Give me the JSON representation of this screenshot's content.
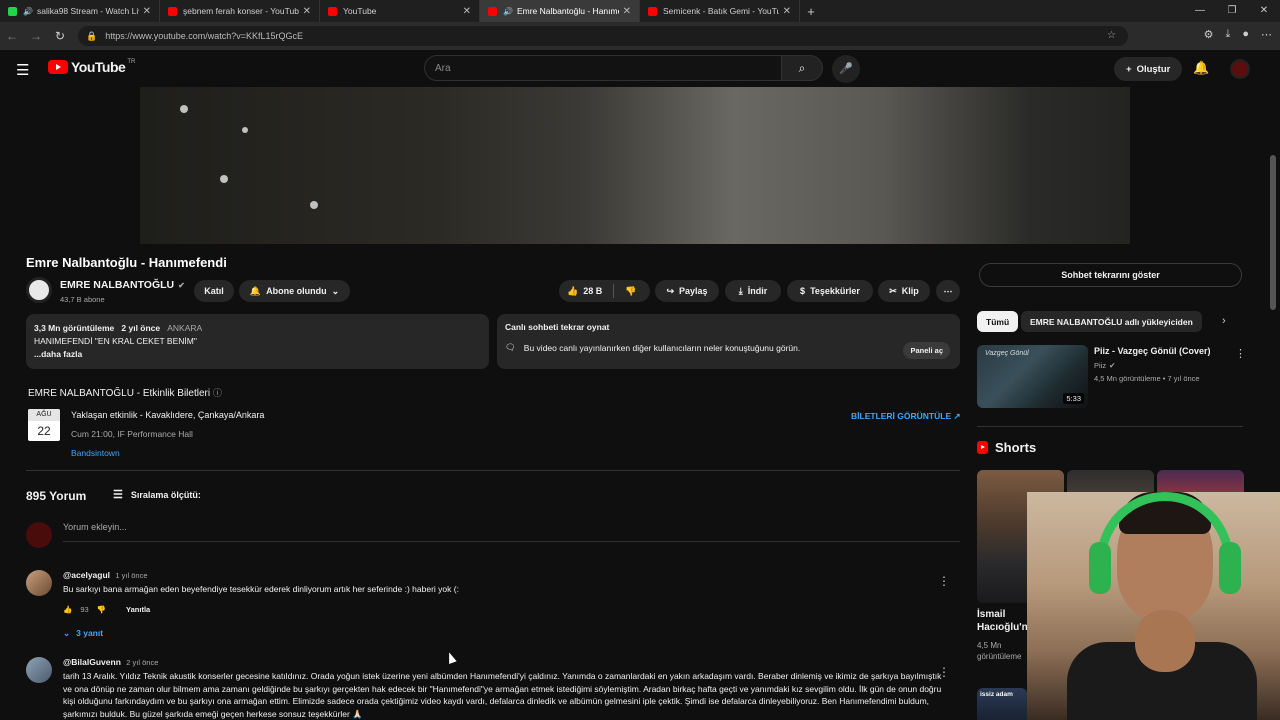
{
  "browser": {
    "tabs": [
      {
        "label": "salika98 Stream - Watch Live",
        "icon": "kick-favicon",
        "audio": true
      },
      {
        "label": "şebnem ferah konser - YouTube",
        "icon": "youtube-favicon",
        "audio": false
      },
      {
        "label": "YouTube",
        "icon": "youtube-favicon",
        "audio": false
      },
      {
        "label": "Emre Nalbantoğlu - Hanımef",
        "icon": "youtube-favicon",
        "audio": true,
        "active": true
      },
      {
        "label": "Semicenk - Batık Gemi - YouTube",
        "icon": "youtube-favicon",
        "audio": false
      }
    ],
    "url": "https://www.youtube.com/watch?v=KKfL15rQGcE"
  },
  "header": {
    "logo_text": "YouTube",
    "region": "TR",
    "search_placeholder": "Ara",
    "create_label": "Oluştur"
  },
  "video": {
    "title": "Emre Nalbantoğlu - Hanımefendi",
    "channel": "EMRE NALBANTOĞLU",
    "subscribers": "43,7 B abone",
    "join_label": "Katıl",
    "subscribed_label": "Abone olundu",
    "likes": "28 B",
    "share_label": "Paylaş",
    "download_label": "İndir",
    "thanks_label": "Teşekkürler",
    "clip_label": "Klip"
  },
  "description": {
    "views": "3,3 Mn görüntüleme",
    "age": "2 yıl önce",
    "location": "ANKARA",
    "line": "HANIMEFENDİ \"EN KRAL CEKET BENİM\"",
    "more": "...daha fazla"
  },
  "livechat_box": {
    "title": "Canlı sohbeti tekrar oynat",
    "text": "Bu video canlı yayınlanırken diğer kullanıcıların neler konuştuğunu görün.",
    "button": "Paneli aç"
  },
  "events": {
    "title": "EMRE NALBANTOĞLU - Etkinlik Biletleri",
    "month": "AĞU",
    "day": "22",
    "event_title": "Yaklaşan etkinlik - Kavaklıdere, Çankaya/Ankara",
    "event_time": "Cum 21:00, IF Performance Hall",
    "source": "Bandsintown",
    "tickets_link": "BİLETLERİ GÖRÜNTÜLE"
  },
  "comments": {
    "count": "895 Yorum",
    "sort_label": "Sıralama ölçütü:",
    "add_placeholder": "Yorum ekleyin...",
    "reply_label": "Yanıtla",
    "items": [
      {
        "user": "@acelyagul",
        "time": "1 yıl önce",
        "text": "Bu sarkıyı bana armağan eden beyefendiye tesekkür ederek dinliyorum artık her seferinde :) haberi yok (:",
        "likes": "93",
        "replies": "3 yanıt"
      },
      {
        "user": "@BilalGuvenn",
        "time": "2 yıl önce",
        "text": "tarih 13 Aralık. Yıldız Teknik akustik konserler gecesine katıldınız. Orada yoğun istek üzerine yeni albümden Hanımefendi'yi çaldınız. Yanımda o zamanlardaki en yakın arkadaşım vardı. Beraber dinlemiş ve ikimiz de şarkıya bayılmıştık ve ona dönüp ne zaman olur bilmem ama zamanı geldiğinde bu şarkıyı gerçekten hak edecek bir \"Hanımefendi\"ye armağan etmek istediğimi söylemiştim. Aradan birkaç hafta geçti ve yanımdaki kız sevgilim oldu. İlk gün de onun doğru kişi olduğunu farkındaydım ve bu şarkıyı ona armağan ettim. Elimizde sadece orada çektiğimiz video kaydı vardı, defalarca dinledik ve albümün gelmesini iple çektik. Şimdi ise defalarca dinleyebiliyoruz. Ben Hanımefendimi buldum, şarkımızı bulduk. Bu güzel şarkıda emeği geçen herkese sonsuz teşekkürler 🙏🏻"
      }
    ]
  },
  "sidebar": {
    "chat_replay_label": "Sohbet tekrarını göster",
    "chips": [
      "Tümü",
      "EMRE NALBANTOĞLU adlı yükleyiciden"
    ],
    "recommended": [
      {
        "title": "Piiz - Vazgeç Gönül (Cover)",
        "channel": "Piiz",
        "meta": "4,5 Mn görüntüleme • 7 yıl önce",
        "thumb_text": "Vazgeç Gönül",
        "duration": "5:33"
      }
    ],
    "shorts_title": "Shorts",
    "shorts": [
      {
        "title": "İsmail Hacıoğlu'n",
        "views": "4,5 Mn görüntüleme"
      }
    ],
    "short4_text": "issiz adam"
  },
  "colors": {
    "background": "#0f0f0f",
    "chip": "#272727",
    "link": "#3ea6ff",
    "brand": "#ff0000"
  }
}
